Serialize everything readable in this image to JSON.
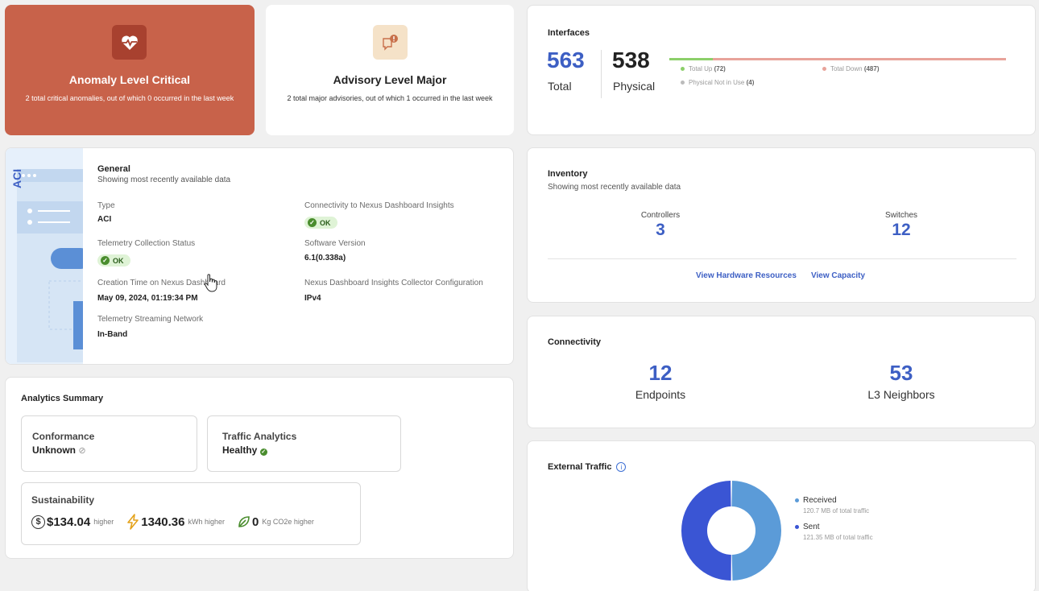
{
  "anomaly": {
    "title": "Anomaly Level Critical",
    "description": "2 total critical anomalies, out of which 0 occurred in the last week",
    "icon": "pulse-icon",
    "color": "#c8624a"
  },
  "advisory": {
    "title": "Advisory Level Major",
    "description": "2 total major advisories, out of which 1 occurred in the last week",
    "icon": "chat-alert-icon"
  },
  "general": {
    "illustration_label": "ACI",
    "title": "General",
    "subtitle": "Showing most recently available data",
    "type_label": "Type",
    "type_value": "ACI",
    "connectivity_label": "Connectivity to Nexus Dashboard Insights",
    "connectivity_value": "OK",
    "telemetry_label": "Telemetry Collection Status",
    "telemetry_value": "OK",
    "software_label": "Software Version",
    "software_value": "6.1(0.338a)",
    "creation_label": "Creation Time on Nexus Dashboard",
    "creation_value": "May 09, 2024, 01:19:34 PM",
    "collector_label": "Nexus Dashboard Insights Collector Configuration",
    "collector_value": "IPv4",
    "streaming_label": "Telemetry Streaming Network",
    "streaming_value": "In-Band"
  },
  "analytics": {
    "title": "Analytics Summary",
    "conformance_label": "Conformance",
    "conformance_value": "Unknown",
    "traffic_label": "Traffic Analytics",
    "traffic_value": "Healthy",
    "sustainability_label": "Sustainability",
    "cost_value": "$134.04",
    "cost_suffix": "higher",
    "energy_value": "1340.36",
    "energy_suffix": "kWh higher",
    "carbon_value": "0",
    "carbon_suffix": "Kg CO2e higher"
  },
  "interfaces": {
    "title": "Interfaces",
    "total_value": "563",
    "total_label": "Total",
    "physical_value": "538",
    "physical_label": "Physical",
    "total_up_label": "Total Up",
    "total_up_value": "(72)",
    "total_down_label": "Total Down",
    "total_down_value": "(487)",
    "not_in_use_label": "Physical Not in Use",
    "not_in_use_value": "(4)",
    "up_fraction": 0.13,
    "colors": {
      "up": "#8ccf6a",
      "down": "#e8a39a",
      "not_in_use": "#bbbbbb"
    }
  },
  "inventory": {
    "title": "Inventory",
    "subtitle": "Showing most recently available data",
    "controllers_label": "Controllers",
    "controllers_value": "3",
    "switches_label": "Switches",
    "switches_value": "12",
    "hardware_link": "View Hardware Resources",
    "capacity_link": "View Capacity"
  },
  "connectivity": {
    "title": "Connectivity",
    "endpoints_value": "12",
    "endpoints_label": "Endpoints",
    "neighbors_value": "53",
    "neighbors_label": "L3 Neighbors"
  },
  "external": {
    "title": "External Traffic",
    "received_label": "Received",
    "received_detail": "120.7 MB of total traffic",
    "sent_label": "Sent",
    "sent_detail": "121.35 MB of total traffic",
    "colors": {
      "received": "#5b9bd8",
      "sent": "#3a55d4"
    }
  },
  "chart_data": {
    "type": "pie",
    "categories": [
      "Received",
      "Sent"
    ],
    "values": [
      120.7,
      121.35
    ]
  }
}
